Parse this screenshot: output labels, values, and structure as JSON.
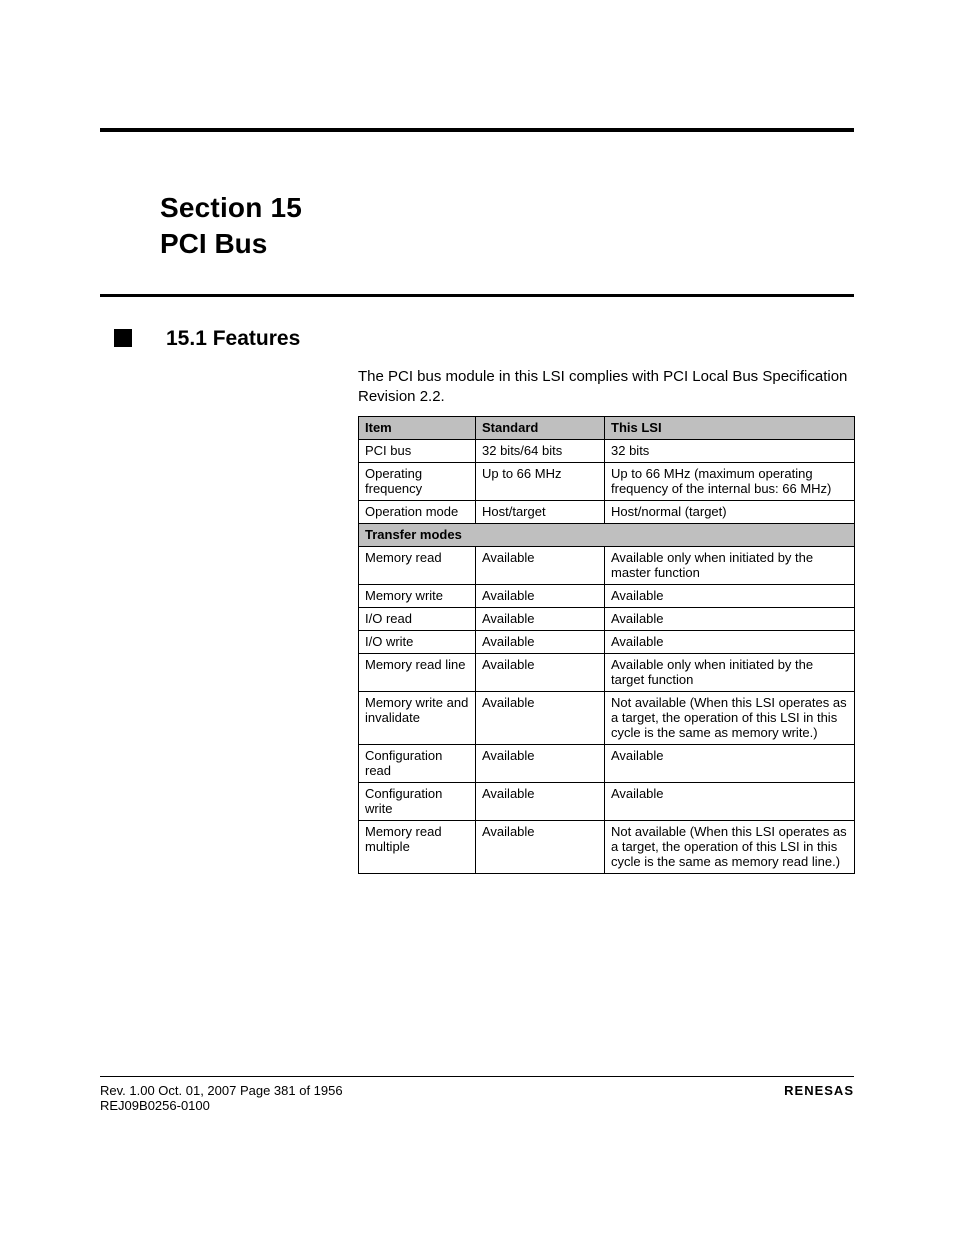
{
  "chapter": {
    "number": "15",
    "title": "PCI Bus"
  },
  "section": {
    "title": "15.1 Features"
  },
  "intro": "The PCI bus module in this LSI complies with PCI Local Bus Specification Revision 2.2.",
  "table": {
    "headers": [
      "Item",
      "Standard",
      "This LSI"
    ],
    "rows": [
      {
        "item": "PCI bus",
        "std": "32 bits/64 bits",
        "lsi": "32 bits"
      },
      {
        "item": "Operating frequency",
        "std": "Up to 66 MHz",
        "lsi": "Up to 66 MHz (maximum operating frequency of the internal bus: 66 MHz)"
      },
      {
        "item": "Operation mode",
        "std": "Host/target",
        "lsi": "Host/normal (target)"
      }
    ],
    "group_label": "Transfer modes",
    "group_rows": [
      {
        "item": "Memory read",
        "std": "Available",
        "lsi": "Available only when initiated by the master function"
      },
      {
        "item": "Memory write",
        "std": "Available",
        "lsi": "Available"
      },
      {
        "item": "I/O read",
        "std": "Available",
        "lsi": "Available"
      },
      {
        "item": "I/O write",
        "std": "Available",
        "lsi": "Available"
      },
      {
        "item": "Memory read line",
        "std": "Available",
        "lsi": "Available only when initiated by the target function"
      },
      {
        "item": "Memory write and invalidate",
        "std": "Available",
        "lsi": "Not available (When this LSI operates as a target, the operation of this LSI in this cycle is the same as memory write.)"
      },
      {
        "item": "Configuration read",
        "std": "Available",
        "lsi": "Available"
      },
      {
        "item": "Configuration write",
        "std": "Available",
        "lsi": "Available"
      },
      {
        "item": "Memory read multiple",
        "std": "Available",
        "lsi": "Not available (When this LSI operates as a target, the operation of this LSI in this cycle is the same as memory read line.)"
      }
    ]
  },
  "footer": {
    "left": "Rev. 1.00  Oct. 01, 2007  Page 381 of 1956",
    "right": "RENESAS",
    "doc": "REJ09B0256-0100"
  }
}
